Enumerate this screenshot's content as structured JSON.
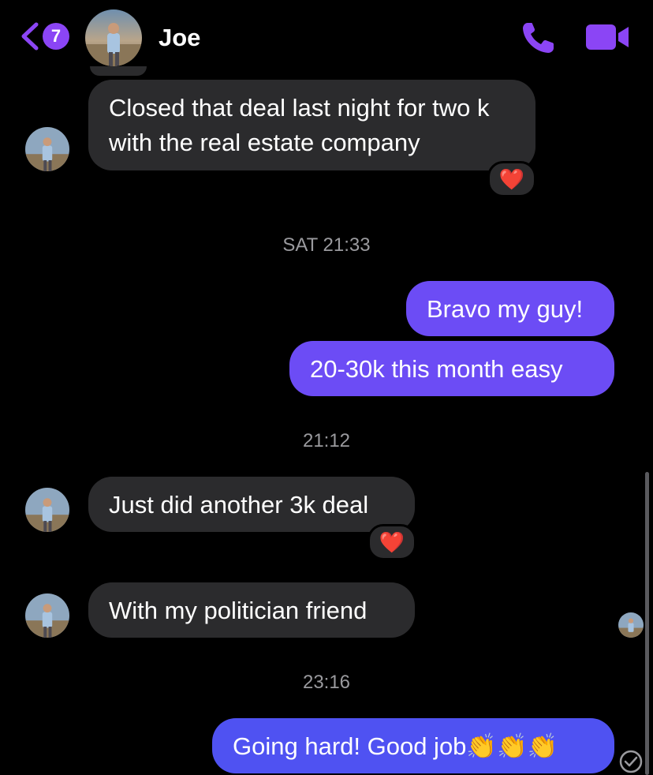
{
  "header": {
    "back_badge_count": "7",
    "contact_name": "Joe",
    "accent_color": "#8b45f5"
  },
  "messages": [
    {
      "side": "in",
      "text": "Closed that deal last night for two k with the real estate company",
      "reaction": "❤️"
    },
    {
      "timestamp": "SAT 21:33"
    },
    {
      "side": "out",
      "text": "Bravo my guy!"
    },
    {
      "side": "out",
      "text": "20-30k this month easy"
    },
    {
      "timestamp": "21:12"
    },
    {
      "side": "in",
      "text": "Just did another 3k deal",
      "reaction": "❤️"
    },
    {
      "side": "in",
      "text": "With my politician friend"
    },
    {
      "timestamp": "23:16"
    },
    {
      "side": "out",
      "text": "Going hard! Good job👏👏👏"
    }
  ],
  "colors": {
    "incoming_bubble": "#2b2b2d",
    "outgoing_bubble": "#6c4cf5",
    "timestamp_text": "#9a9a9e"
  },
  "icons": [
    "back-chevron-icon",
    "phone-icon",
    "video-camera-icon",
    "heart-reaction-icon",
    "read-receipt-avatar-icon",
    "sent-check-icon"
  ]
}
